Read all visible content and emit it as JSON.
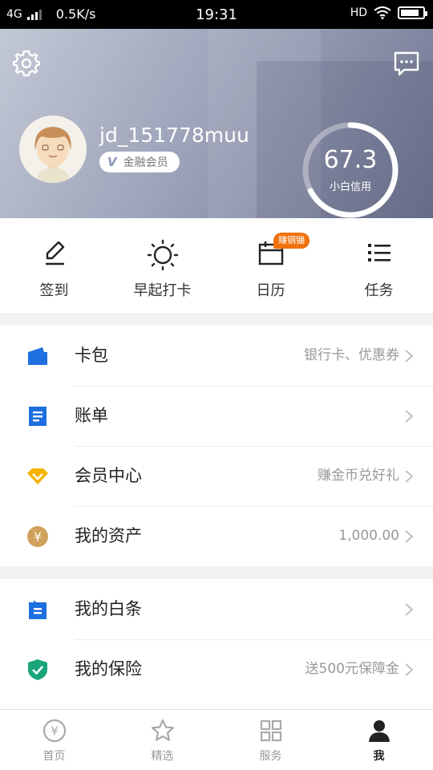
{
  "status_bar": {
    "network": "4G",
    "speed": "0.5K/s",
    "time": "19:31",
    "hd": "HD",
    "icons": [
      "signal-icon",
      "wifi-icon",
      "battery-icon"
    ]
  },
  "header": {
    "username": "jd_151778muu",
    "member_label": "金融会员",
    "member_badge_glyph": "V",
    "credit_score": "67.3",
    "credit_fraction": 0.673,
    "credit_label": "小白信用",
    "icons": [
      "gear-icon",
      "message-icon"
    ]
  },
  "quick_actions": [
    {
      "label": "签到",
      "icon": "pen-icon"
    },
    {
      "label": "早起打卡",
      "icon": "sun-icon"
    },
    {
      "label": "日历",
      "icon": "calendar-icon",
      "badge": "赚钢镚"
    },
    {
      "label": "任务",
      "icon": "list-icon"
    }
  ],
  "menu_group_1": [
    {
      "title": "卡包",
      "extra": "银行卡、优惠券",
      "icon": "wallet-icon"
    },
    {
      "title": "账单",
      "extra": "",
      "icon": "bill-icon"
    },
    {
      "title": "会员中心",
      "extra": "赚金币兑好礼",
      "icon": "diamond-icon"
    },
    {
      "title": "我的资产",
      "extra": "1,000.00",
      "icon": "yuan-coin-icon"
    }
  ],
  "menu_group_2": [
    {
      "title": "我的白条",
      "extra": "",
      "icon": "iou-icon"
    },
    {
      "title": "我的保险",
      "extra": "送500元保障金",
      "icon": "shield-check-icon"
    }
  ],
  "tab_bar": [
    {
      "label": "首页",
      "icon": "home-yuan-icon",
      "active": false
    },
    {
      "label": "精选",
      "icon": "star-icon",
      "active": false
    },
    {
      "label": "服务",
      "icon": "grid-icon",
      "active": false
    },
    {
      "label": "我",
      "icon": "person-icon",
      "active": true
    }
  ],
  "colors": {
    "accent_blue": "#1e6fe0",
    "diamond_yellow": "#f5b400",
    "coin_gold": "#cfa15b",
    "shield_green": "#19a67a",
    "badge_orange": "#f0720f"
  }
}
